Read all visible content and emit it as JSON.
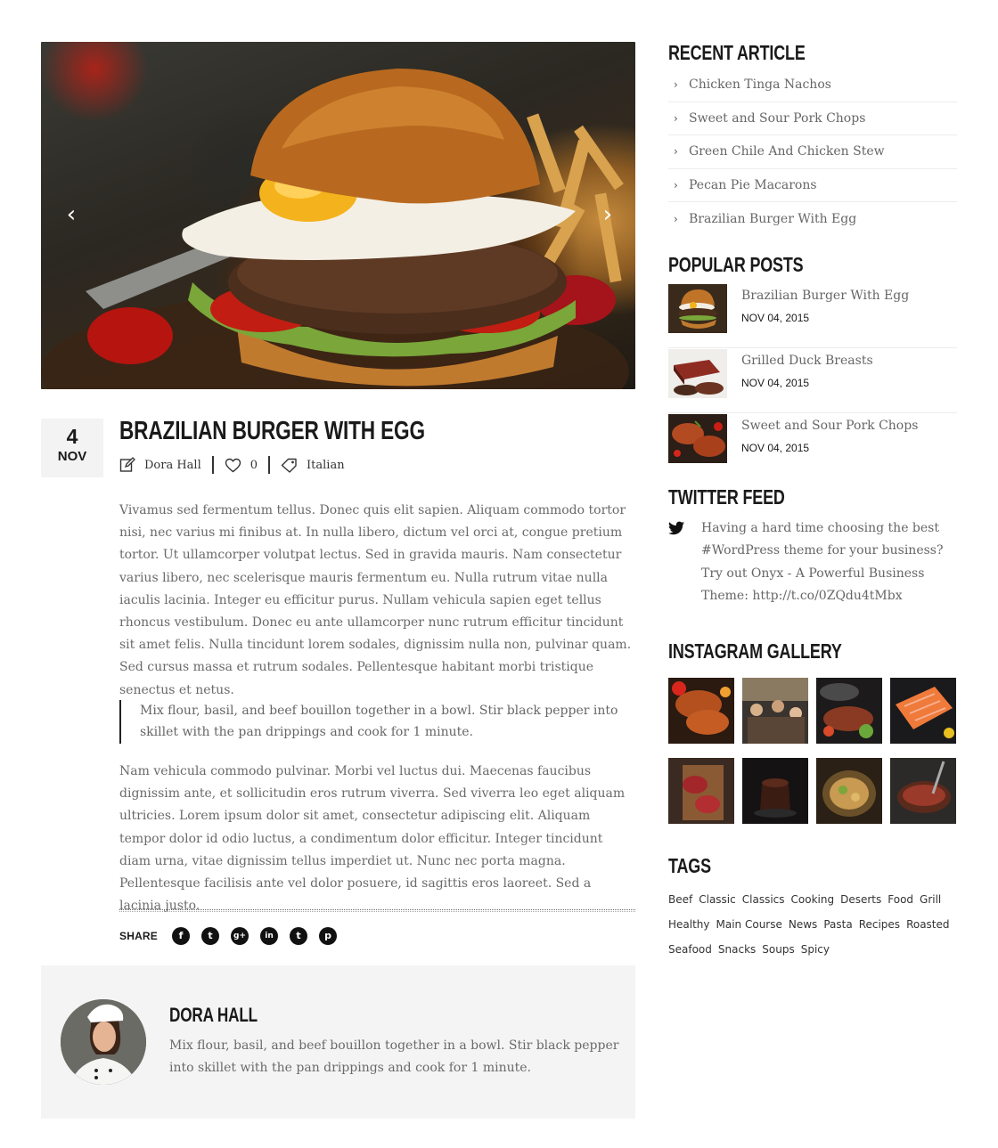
{
  "slider": {
    "prev_label": "‹",
    "next_label": "›"
  },
  "post": {
    "day": "4",
    "month": "NOV",
    "title": "BRAZILIAN BURGER WITH EGG",
    "author": "Dora Hall",
    "likes": "0",
    "category": "Italian",
    "paragraph1": "Vivamus sed fermentum tellus. Donec quis elit sapien. Aliquam commodo tortor nisi, nec varius mi finibus at. In nulla libero, dictum vel orci at, congue pretium tortor. Ut ullamcorper volutpat lectus. Sed in gravida mauris. Nam consectetur varius libero, nec scelerisque mauris fermentum eu. Nulla rutrum vitae nulla iaculis lacinia. Integer eu efficitur purus. Nullam vehicula sapien eget tellus rhoncus vestibulum. Donec eu ante ullamcorper nunc rutrum efficitur tincidunt sit amet felis. Nulla tincidunt lorem sodales, dignissim nulla non, pulvinar quam. Sed cursus massa et rutrum sodales. Pellentesque habitant morbi tristique senectus et netus.",
    "quote": "Mix flour, basil, and beef bouillon together in a bowl. Stir black pepper into skillet with the pan drippings and cook for 1 minute.",
    "paragraph2": "Nam vehicula commodo pulvinar. Morbi vel luctus dui. Maecenas faucibus dignissim ante, et sollicitudin eros rutrum viverra. Sed viverra leo eget aliquam ultricies. Lorem ipsum dolor sit amet, consectetur adipiscing elit. Aliquam tempor dolor id odio luctus, a condimentum dolor efficitur. Integer tincidunt diam urna, vitae dignissim tellus imperdiet ut. Nunc nec porta magna. Pellentesque facilisis ante vel dolor posuere, id sagittis eros laoreet. Sed a lacinia justo."
  },
  "share": {
    "label": "SHARE",
    "networks": [
      {
        "icon": "facebook-icon",
        "glyph": "f"
      },
      {
        "icon": "twitter-icon",
        "glyph": "t"
      },
      {
        "icon": "google-plus-icon",
        "glyph": "g+"
      },
      {
        "icon": "linkedin-icon",
        "glyph": "in"
      },
      {
        "icon": "tumblr-icon",
        "glyph": "t"
      },
      {
        "icon": "pinterest-icon",
        "glyph": "p"
      }
    ]
  },
  "author_box": {
    "name": "DORA HALL",
    "bio": "Mix flour, basil, and beef bouillon together in a bowl. Stir black pepper into skillet with the pan drippings and cook for 1 minute."
  },
  "sidebar": {
    "recent_heading": "RECENT ARTICLE",
    "recent": [
      "Chicken Tinga Nachos",
      "Sweet and Sour Pork Chops",
      "Green Chile And Chicken Stew",
      "Pecan Pie Macarons",
      "Brazilian Burger With Egg"
    ],
    "popular_heading": "POPULAR POSTS",
    "popular": [
      {
        "title": "Brazilian Burger With Egg",
        "date": "NOV 04, 2015"
      },
      {
        "title": "Grilled Duck Breasts",
        "date": "NOV 04, 2015"
      },
      {
        "title": "Sweet and Sour Pork Chops",
        "date": "NOV 04, 2015"
      }
    ],
    "twitter_heading": "TWITTER FEED",
    "tweet": "Having a hard time choosing the best #WordPress theme for your business? Try out Onyx - A Powerful Business Theme: http://t.co/0ZQdu4tMbx",
    "instagram_heading": "INSTAGRAM GALLERY",
    "tags_heading": "TAGS",
    "tags": [
      "Beef",
      "Classic",
      "Classics",
      "Cooking",
      "Deserts",
      "Food",
      "Grill",
      "Healthy",
      "Main Course",
      "News",
      "Pasta",
      "Recipes",
      "Roasted",
      "Seafood",
      "Snacks",
      "Soups",
      "Spicy"
    ]
  },
  "colors": {
    "heading": "#1a1a1a",
    "body_text": "#6a6a6a",
    "panel_bg": "#f4f4f4"
  }
}
